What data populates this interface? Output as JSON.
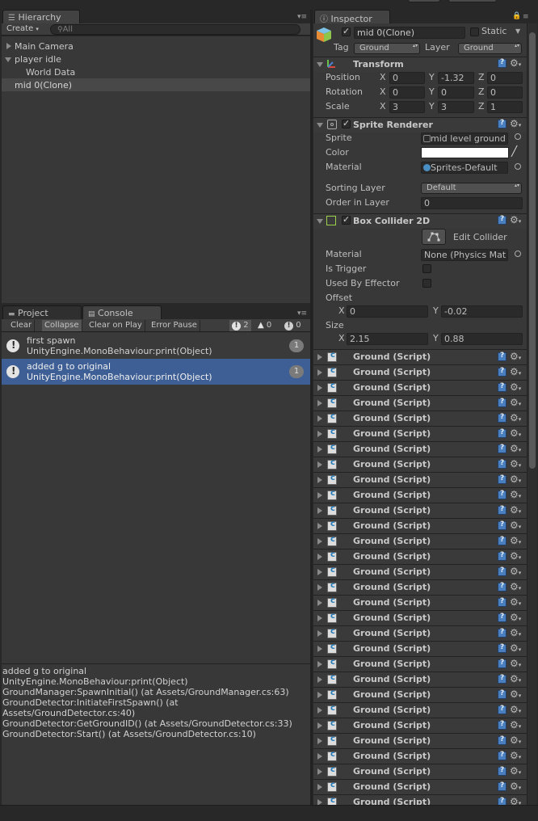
{
  "hierarchy": {
    "tab_label": "Hierarchy",
    "create_label": "Create",
    "search_placeholder": "All",
    "items": [
      {
        "label": "Main Camera"
      },
      {
        "label": "player idle"
      },
      {
        "label": "World Data"
      },
      {
        "label": "mid 0(Clone)"
      }
    ]
  },
  "bottom_tabs": {
    "project": "Project",
    "console": "Console"
  },
  "console": {
    "buttons": {
      "clear": "Clear",
      "collapse": "Collapse",
      "clear_on_play": "Clear on Play",
      "error_pause": "Error Pause"
    },
    "counts": {
      "info": "2",
      "warning": "0",
      "error": "0"
    },
    "entries": [
      {
        "line1": "first spawn",
        "line2": "UnityEngine.MonoBehaviour:print(Object)",
        "count": "1"
      },
      {
        "line1": "added g to original",
        "line2": "UnityEngine.MonoBehaviour:print(Object)",
        "count": "1"
      }
    ],
    "detail": [
      "added g to original",
      "UnityEngine.MonoBehaviour:print(Object)",
      "GroundManager:SpawnInitial() (at Assets/GroundManager.cs:63)",
      "GroundDetector:InitiateFirstSpawn() (at",
      "Assets/GroundDetector.cs:40)",
      "GroundDetector:GetGroundID() (at Assets/GroundDetector.cs:33)",
      "GroundDetector:Start() (at Assets/GroundDetector.cs:10)"
    ]
  },
  "inspector": {
    "tab_label": "Inspector",
    "object_name": "mid 0(Clone)",
    "static_label": "Static",
    "tag_label": "Tag",
    "tag_value": "Ground",
    "layer_label": "Layer",
    "layer_value": "Ground",
    "transform": {
      "title": "Transform",
      "position_label": "Position",
      "rotation_label": "Rotation",
      "scale_label": "Scale",
      "axis": {
        "x": "X",
        "y": "Y",
        "z": "Z"
      },
      "position": {
        "x": "0",
        "y": "-1.32",
        "z": "0"
      },
      "rotation": {
        "x": "0",
        "y": "0",
        "z": "0"
      },
      "scale": {
        "x": "3",
        "y": "3",
        "z": "1"
      }
    },
    "sprite_renderer": {
      "title": "Sprite Renderer",
      "sprite_label": "Sprite",
      "sprite_value": "mid level ground",
      "color_label": "Color",
      "color_value": "#ffffff",
      "material_label": "Material",
      "material_value": "Sprites-Default",
      "sorting_layer_label": "Sorting Layer",
      "sorting_layer_value": "Default",
      "order_label": "Order in Layer",
      "order_value": "0"
    },
    "box_collider": {
      "title": "Box Collider 2D",
      "edit_collider_label": "Edit Collider",
      "material_label": "Material",
      "material_value": "None (Physics Mat",
      "is_trigger_label": "Is Trigger",
      "used_by_effector_label": "Used By Effector",
      "offset_label": "Offset",
      "offset": {
        "x": "0",
        "y": "-0.02"
      },
      "size_label": "Size",
      "size": {
        "x": "2.15",
        "y": "0.88"
      },
      "axis": {
        "x": "X",
        "y": "Y"
      }
    },
    "ground_script_title": "Ground (Script)"
  }
}
